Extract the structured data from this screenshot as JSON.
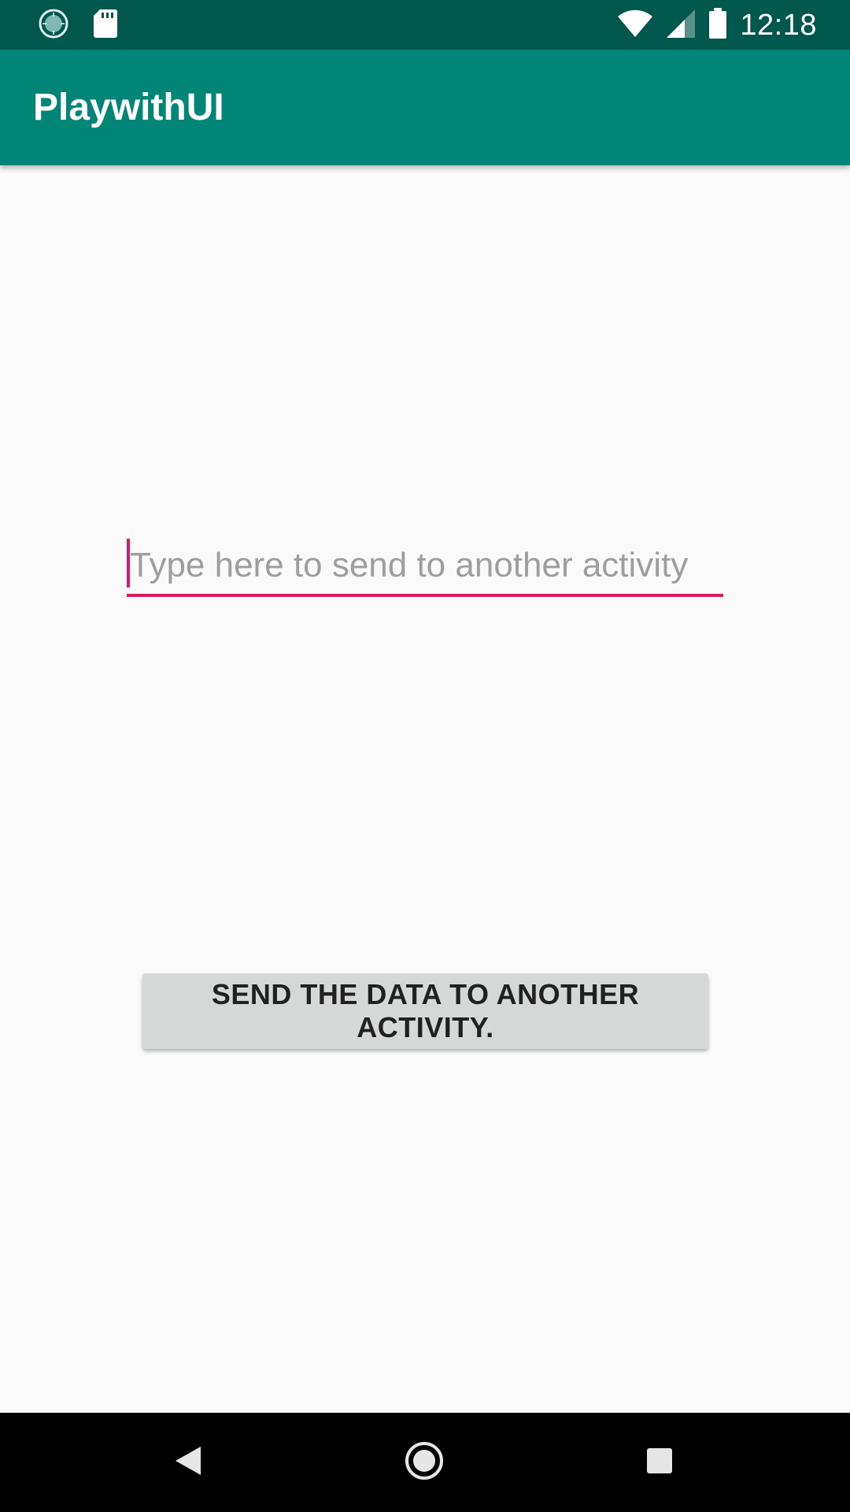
{
  "status_bar": {
    "time": "12:18",
    "background": "#00574b",
    "left_icons": [
      "sync-progress-icon",
      "sd-card-icon"
    ],
    "right_icons": [
      "wifi-icon",
      "cell-signal-icon",
      "battery-icon"
    ]
  },
  "app_bar": {
    "title": "PlaywithUI",
    "background": "#008577"
  },
  "main": {
    "input": {
      "value": "",
      "placeholder": "Type here to send to another activity",
      "accent_color": "#d81b60"
    },
    "send_button": {
      "label": "SEND THE DATA TO ANOTHER ACTIVITY."
    }
  },
  "nav_bar": {
    "buttons": [
      "back-icon",
      "home-icon",
      "recents-icon"
    ]
  }
}
